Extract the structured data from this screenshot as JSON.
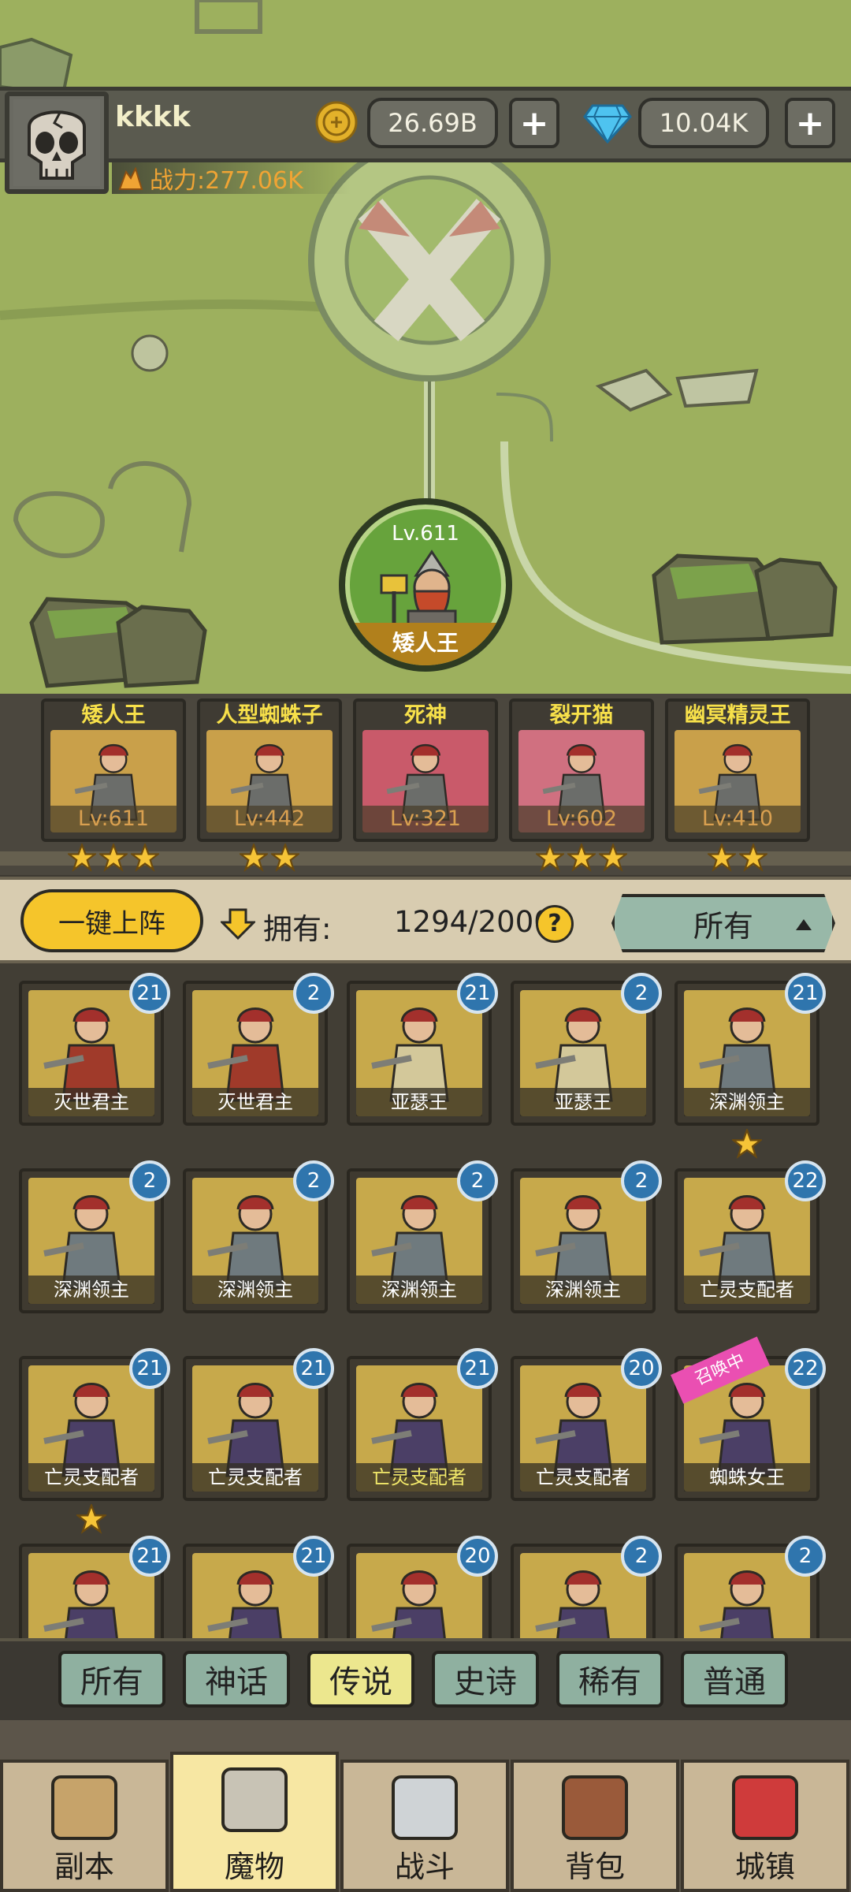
{
  "player": {
    "name": "kkkk",
    "gold": "26.69B",
    "gems": "10.04K",
    "power": "战力:277.06K"
  },
  "featured": {
    "level": "Lv.611",
    "name": "矮人王"
  },
  "team": [
    {
      "name": "矮人王",
      "level": "Lv:611",
      "stars": 3,
      "color": "#c9a04a"
    },
    {
      "name": "人型蜘蛛子",
      "level": "Lv:442",
      "stars": 2,
      "color": "#c9a04a"
    },
    {
      "name": "死神",
      "level": "Lv:321",
      "stars": 0,
      "color": "#c95a6a"
    },
    {
      "name": "裂开猫",
      "level": "Lv:602",
      "stars": 3,
      "color": "#d07080"
    },
    {
      "name": "幽冥精灵王",
      "level": "Lv:410",
      "stars": 2,
      "color": "#c9a04a"
    }
  ],
  "controls": {
    "one_click": "一键上阵",
    "own_label": "拥有:",
    "own_count": "1294/2000",
    "help": "?",
    "filter": "所有"
  },
  "grid": [
    {
      "name": "灭世君主",
      "badge": "21"
    },
    {
      "name": "灭世君主",
      "badge": "2"
    },
    {
      "name": "亚瑟王",
      "badge": "21"
    },
    {
      "name": "亚瑟王",
      "badge": "2"
    },
    {
      "name": "深渊领主",
      "badge": "21",
      "star": true
    },
    {
      "name": "深渊领主",
      "badge": "2"
    },
    {
      "name": "深渊领主",
      "badge": "2"
    },
    {
      "name": "深渊领主",
      "badge": "2"
    },
    {
      "name": "深渊领主",
      "badge": "2"
    },
    {
      "name": "亡灵支配者",
      "badge": "22"
    },
    {
      "name": "亡灵支配者",
      "badge": "21",
      "star": true
    },
    {
      "name": "亡灵支配者",
      "badge": "21"
    },
    {
      "name": "亡灵支配者",
      "badge": "21",
      "highlight": true
    },
    {
      "name": "亡灵支配者",
      "badge": "20"
    },
    {
      "name": "蜘蛛女王",
      "badge": "22",
      "tag": "召唤中"
    },
    {
      "name": "",
      "badge": "21"
    },
    {
      "name": "",
      "badge": "21"
    },
    {
      "name": "",
      "badge": "20"
    },
    {
      "name": "",
      "badge": "2"
    },
    {
      "name": "",
      "badge": "2"
    }
  ],
  "rarity_tabs": [
    "所有",
    "神话",
    "传说",
    "史诗",
    "稀有",
    "普通"
  ],
  "active_rarity": 2,
  "nav": [
    "副本",
    "魔物",
    "战斗",
    "背包",
    "城镇"
  ],
  "active_nav": 1
}
